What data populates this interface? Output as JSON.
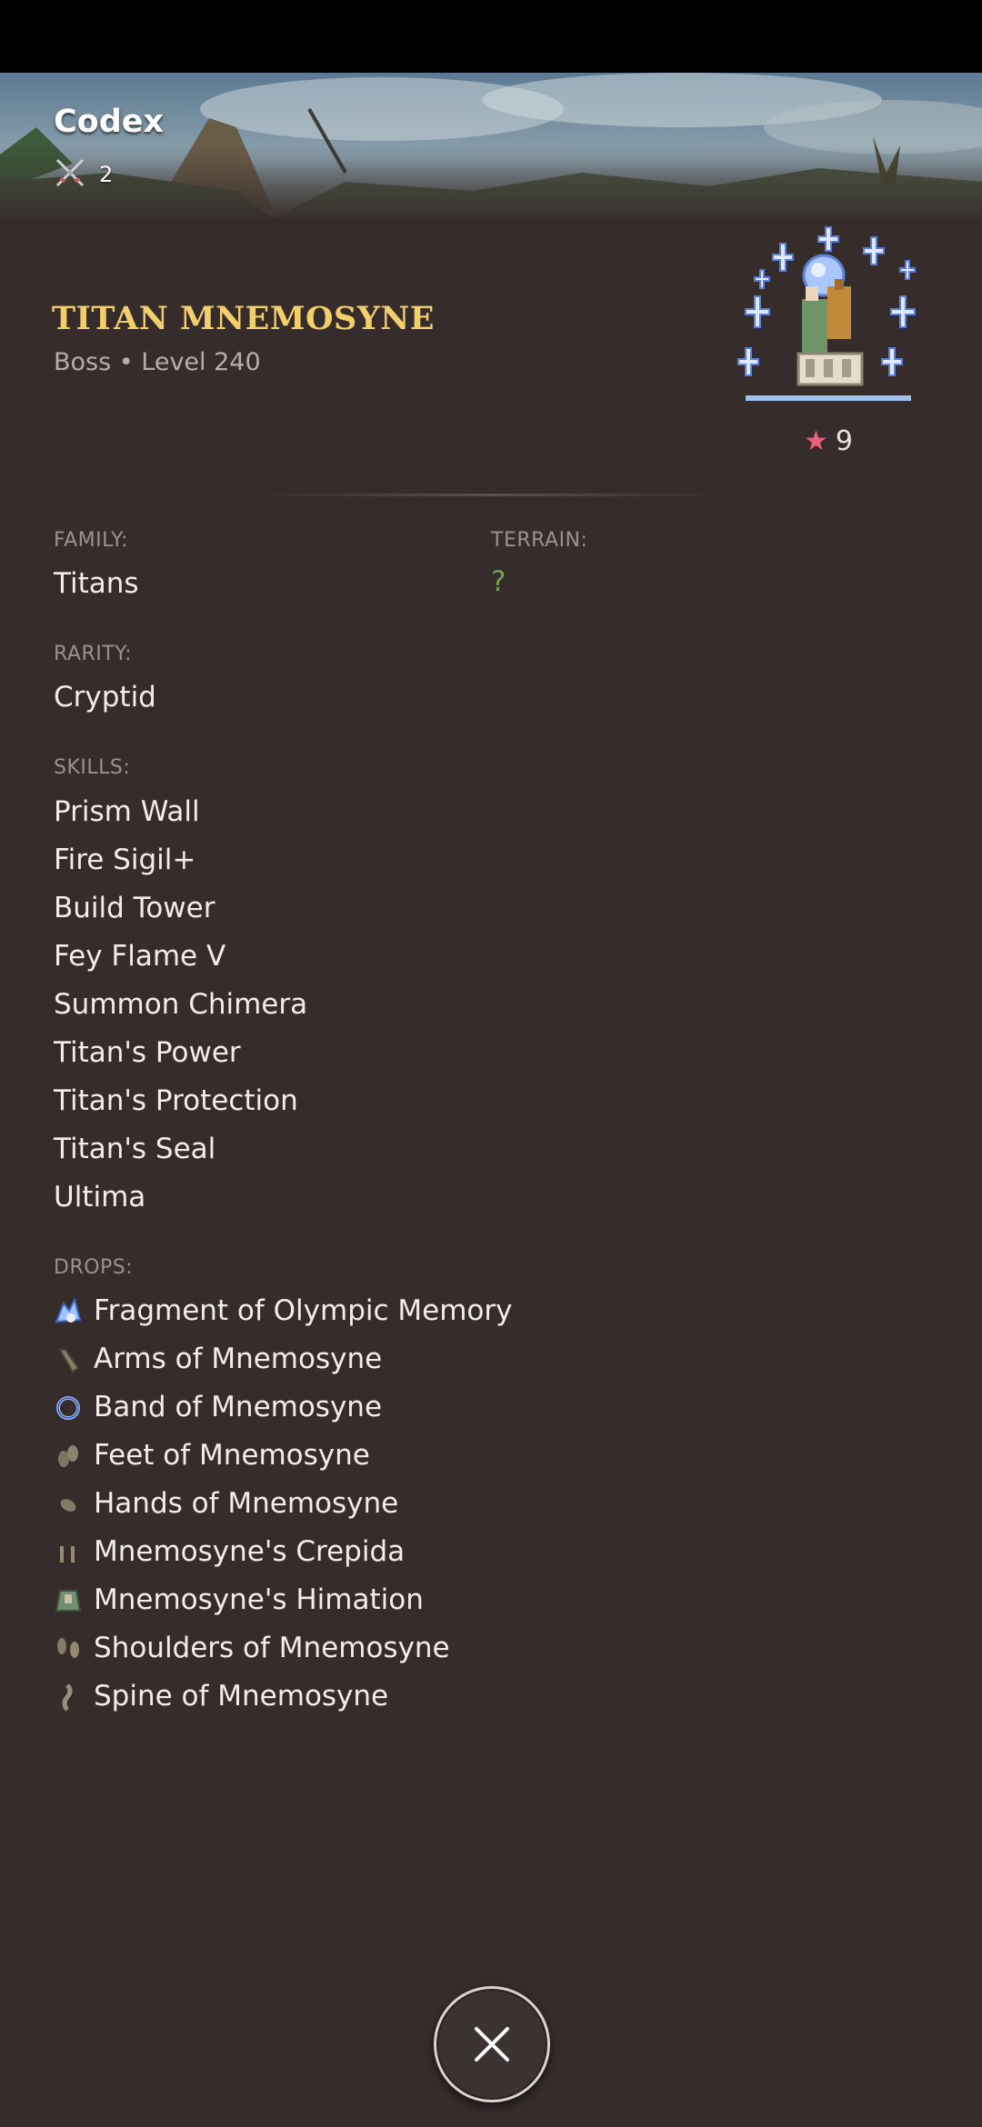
{
  "header": {
    "title": "Codex",
    "count": "2",
    "count_icon": "crossed-swords-icon"
  },
  "monster": {
    "name": "TITAN MNEMOSYNE",
    "meta": "Boss • Level 240",
    "stars": "9"
  },
  "details": {
    "family_label": "FAMILY:",
    "family_value": "Titans",
    "terrain_label": "TERRAIN:",
    "terrain_value": "?",
    "rarity_label": "RARITY:",
    "rarity_value": "Cryptid",
    "skills_label": "SKILLS:",
    "drops_label": "DROPS:"
  },
  "skills": [
    "Prism Wall",
    "Fire Sigil+",
    "Build Tower",
    "Fey Flame V",
    "Summon Chimera",
    "Titan's Power",
    "Titan's Protection",
    "Titan's Seal",
    "Ultima"
  ],
  "drops": [
    {
      "label": "Fragment of Olympic Memory",
      "icon": "memory-fragment-icon"
    },
    {
      "label": "Arms of Mnemosyne",
      "icon": "arms-icon"
    },
    {
      "label": "Band of Mnemosyne",
      "icon": "ring-icon"
    },
    {
      "label": "Feet of Mnemosyne",
      "icon": "feet-icon"
    },
    {
      "label": "Hands of Mnemosyne",
      "icon": "hands-icon"
    },
    {
      "label": "Mnemosyne's Crepida",
      "icon": "crepida-icon"
    },
    {
      "label": "Mnemosyne's Himation",
      "icon": "himation-icon"
    },
    {
      "label": "Shoulders of Mnemosyne",
      "icon": "shoulders-icon"
    },
    {
      "label": "Spine of Mnemosyne",
      "icon": "spine-icon"
    }
  ],
  "colors": {
    "background": "#362c2c",
    "title_gold": "#f2cf6b",
    "terrain_green": "#6fa64a",
    "star_pink": "#e8607a"
  },
  "close_icon": "close-icon"
}
